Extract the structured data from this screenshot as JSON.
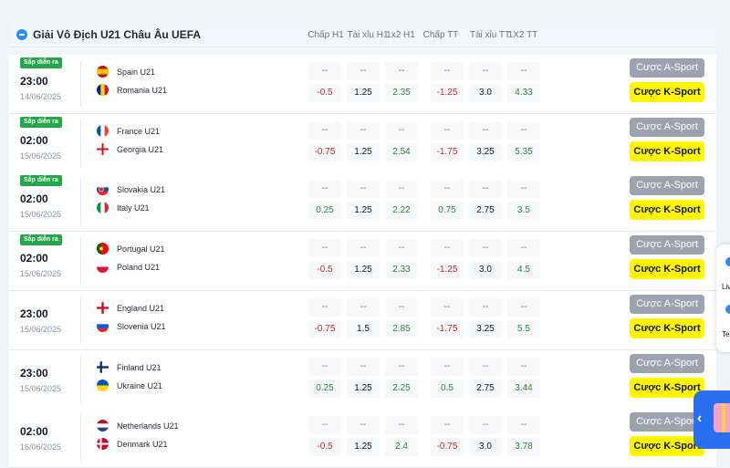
{
  "league": {
    "title": "Giải Vô Địch U21 Châu Âu UEFA",
    "columns": [
      "Chấp H1",
      "Tài xỉu H1",
      "1x2 H1",
      "Chấp TT",
      "Tài xỉu TT",
      "1X2 TT"
    ]
  },
  "buttons": {
    "a_sport": "Cược A-Sport",
    "k_sport": "Cược K-Sport"
  },
  "matches": [
    {
      "badge": "Sắp diễn ra",
      "time": "23:00",
      "date": "14/06/2025",
      "home": {
        "name": "Spain U21",
        "flag": "spain"
      },
      "away": {
        "name": "Romania U21",
        "flag": "romania"
      },
      "row1": [
        "--",
        "--",
        "--",
        "--",
        "--",
        "--"
      ],
      "row2": [
        "-0.5",
        "1.25",
        "2.35",
        "-1.25",
        "3.0",
        "4.33"
      ]
    },
    {
      "badge": "Sắp diễn ra",
      "time": "02:00",
      "date": "15/06/2025",
      "home": {
        "name": "France U21",
        "flag": "france"
      },
      "away": {
        "name": "Georgia U21",
        "flag": "georgia"
      },
      "row1": [
        "--",
        "--",
        "--",
        "--",
        "--",
        "--"
      ],
      "row2": [
        "-0.75",
        "1.25",
        "2.54",
        "-1.75",
        "3.25",
        "5.35"
      ]
    },
    {
      "badge": "Sắp diễn ra",
      "time": "02:00",
      "date": "15/06/2025",
      "home": {
        "name": "Slovakia U21",
        "flag": "slovakia"
      },
      "away": {
        "name": "Italy U21",
        "flag": "italy"
      },
      "row1": [
        "--",
        "--",
        "--",
        "--",
        "--",
        "--"
      ],
      "row2": [
        "0.25",
        "1.25",
        "2.22",
        "0.75",
        "2.75",
        "3.5"
      ]
    },
    {
      "badge": "Sắp diễn ra",
      "time": "02:00",
      "date": "15/06/2025",
      "home": {
        "name": "Portugal U21",
        "flag": "portugal"
      },
      "away": {
        "name": "Poland U21",
        "flag": "poland"
      },
      "row1": [
        "--",
        "--",
        "--",
        "--",
        "--",
        "--"
      ],
      "row2": [
        "-0.5",
        "1.25",
        "2.33",
        "-1.25",
        "3.0",
        "4.5"
      ]
    },
    {
      "badge": "",
      "time": "23:00",
      "date": "15/06/2025",
      "home": {
        "name": "England U21",
        "flag": "england"
      },
      "away": {
        "name": "Slovenia U21",
        "flag": "slovenia"
      },
      "row1": [
        "--",
        "--",
        "--",
        "--",
        "--",
        "--"
      ],
      "row2": [
        "-0.75",
        "1.5",
        "2.85",
        "-1.75",
        "3.25",
        "5.5"
      ]
    },
    {
      "badge": "",
      "time": "23:00",
      "date": "15/06/2025",
      "home": {
        "name": "Finland U21",
        "flag": "finland"
      },
      "away": {
        "name": "Ukraine U21",
        "flag": "ukraine"
      },
      "row1": [
        "--",
        "--",
        "--",
        "--",
        "--",
        "--"
      ],
      "row2": [
        "0.25",
        "1.25",
        "2.25",
        "0.5",
        "2.75",
        "3.44"
      ]
    },
    {
      "badge": "",
      "time": "02:00",
      "date": "16/06/2025",
      "home": {
        "name": "Netherlands U21",
        "flag": "netherlands"
      },
      "away": {
        "name": "Denmark U21",
        "flag": "denmark"
      },
      "row1": [
        "--",
        "--",
        "--",
        "--",
        "--",
        "--"
      ],
      "row2": [
        "-0.5",
        "1.25",
        "2.4",
        "-0.75",
        "3.0",
        "3.78"
      ]
    }
  ],
  "side_widget": {
    "items": [
      "Liv",
      "Tel"
    ]
  },
  "colors": {
    "accent": "#2c8ef8",
    "k_sport": "#fff500",
    "a_sport": "#9ca3af",
    "badge": "#22a84a",
    "negative": "#c62828",
    "positive": "#2e8540"
  }
}
